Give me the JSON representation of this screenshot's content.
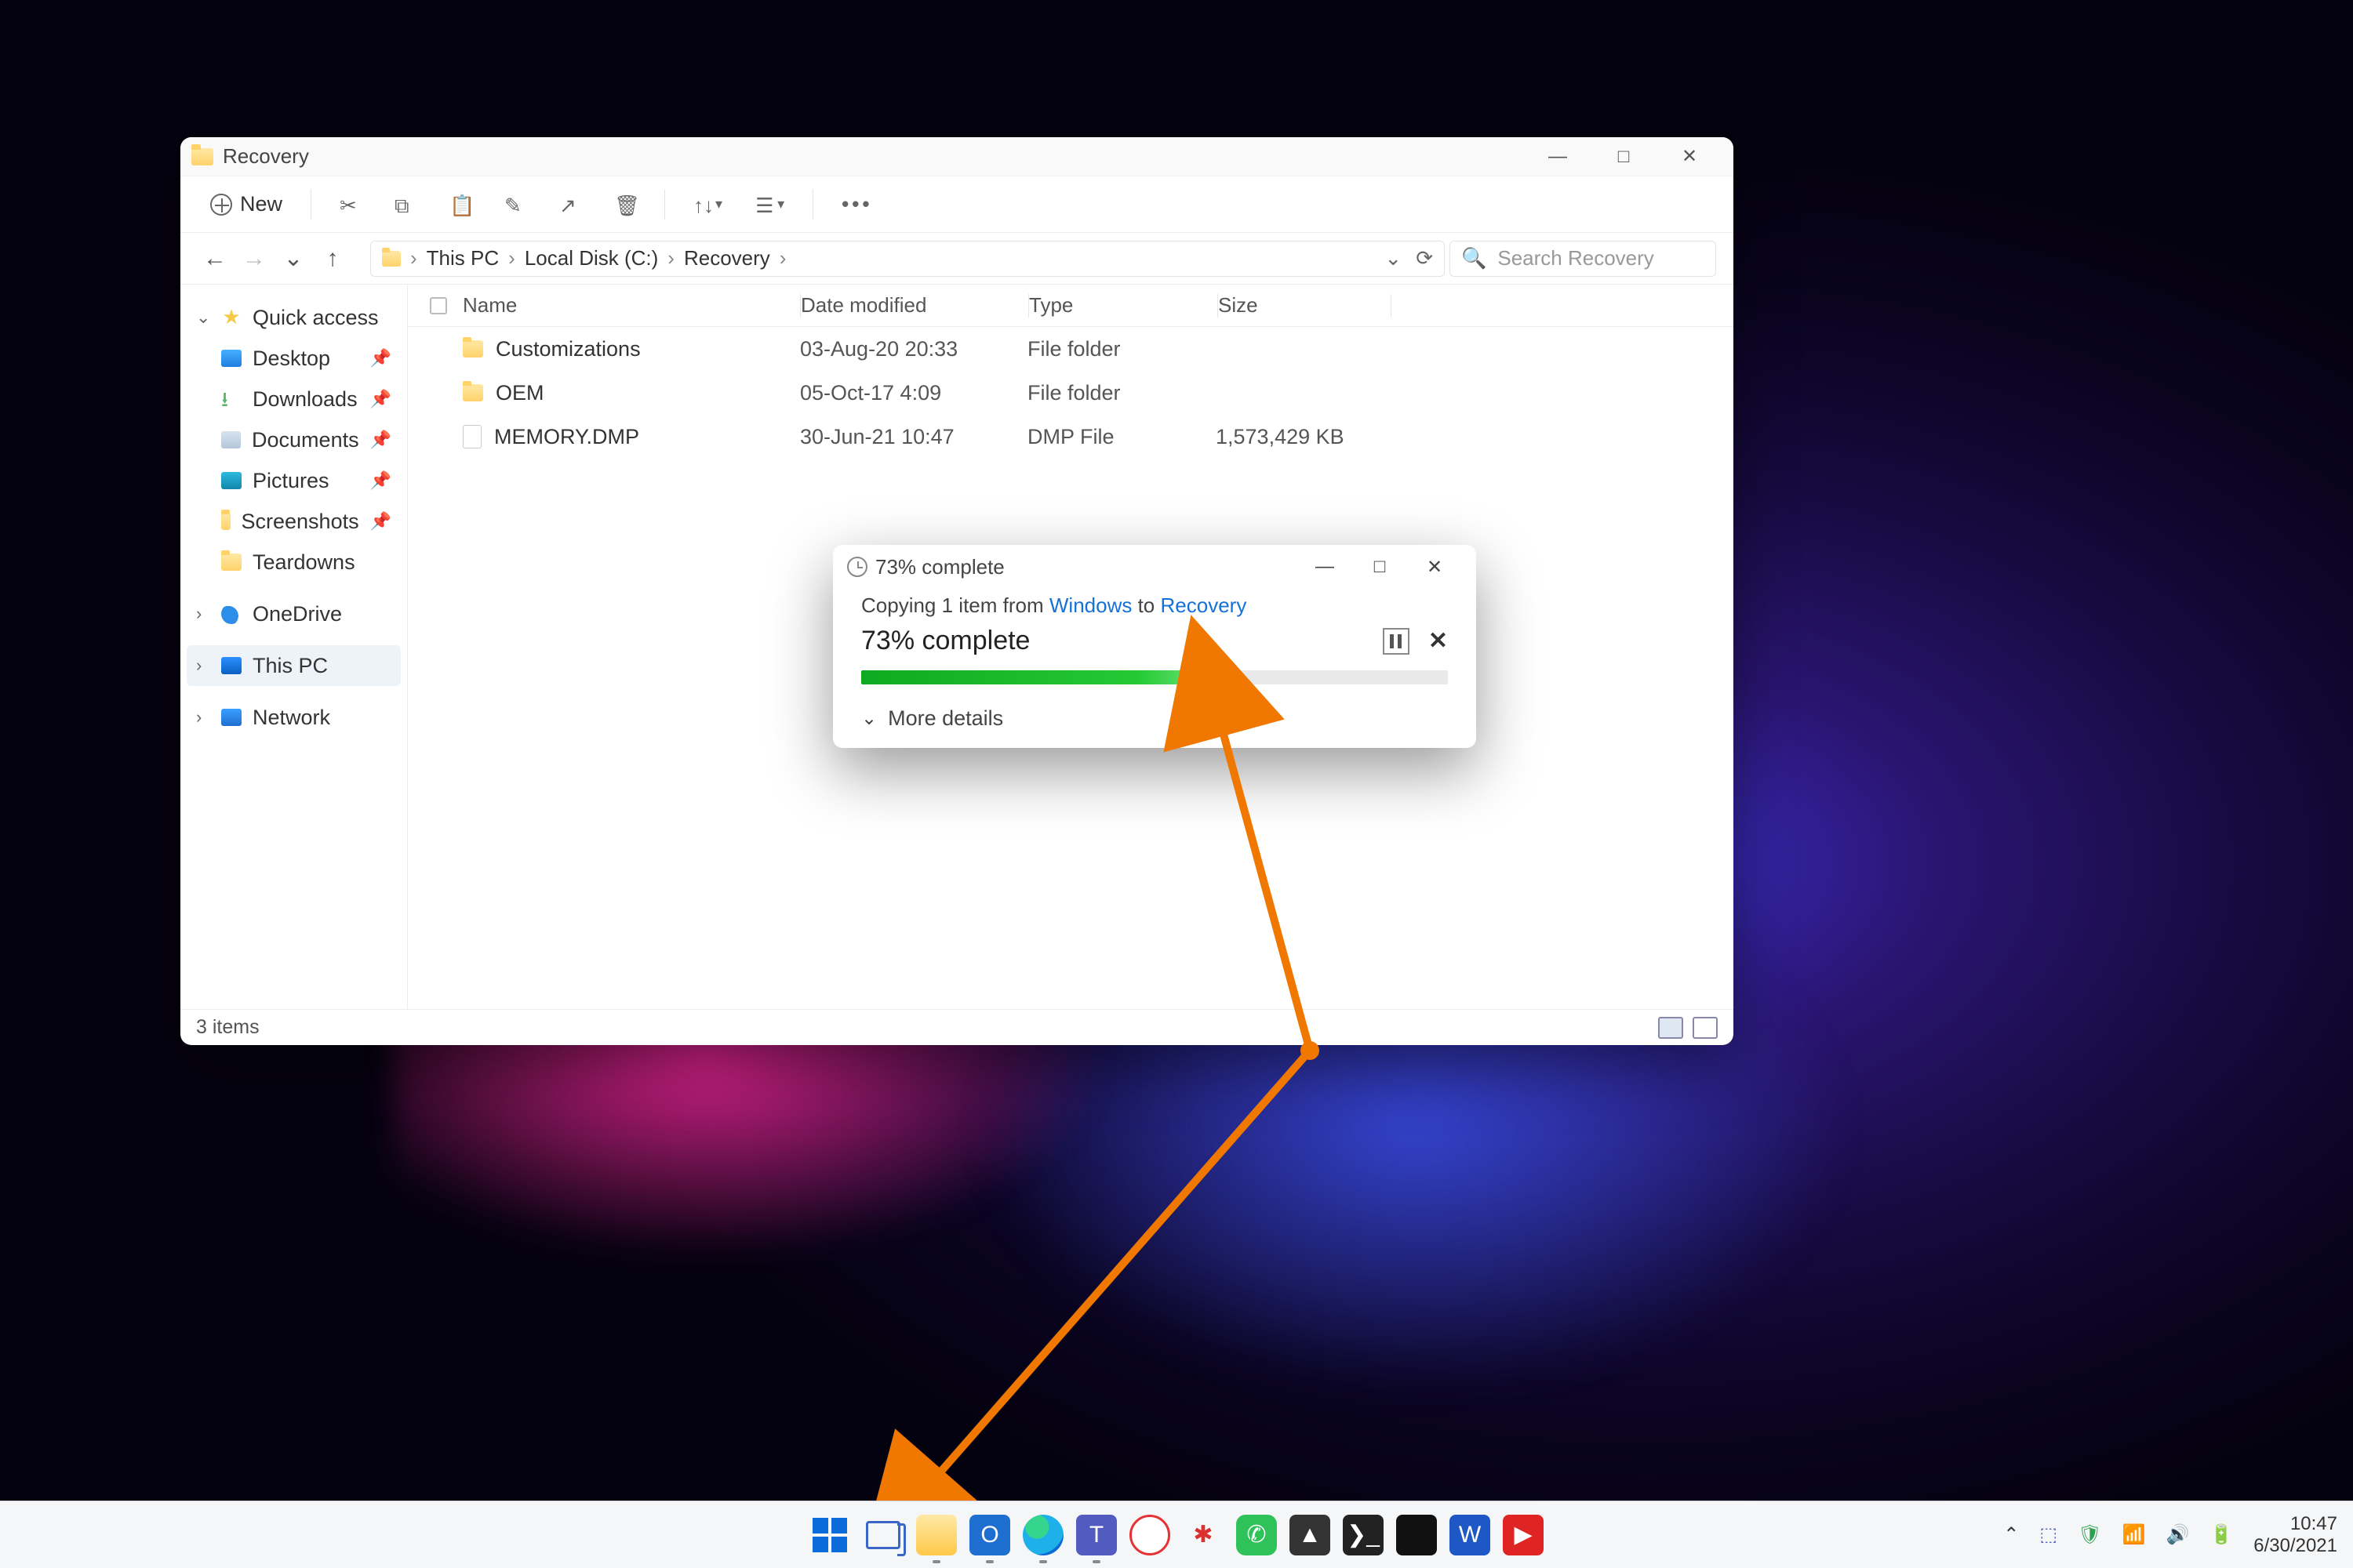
{
  "window": {
    "title": "Recovery",
    "controls": {
      "min": "—",
      "max": "□",
      "close": "✕"
    },
    "toolbar": {
      "new": "New",
      "icons": [
        "cut",
        "copy",
        "paste",
        "rename",
        "share",
        "delete",
        "sort",
        "view",
        "more"
      ]
    },
    "nav": {
      "back": "←",
      "forward": "→",
      "recent": "⌄",
      "up": "↑",
      "dropdown": "⌄",
      "refresh": "⟳"
    },
    "breadcrumb": [
      "This PC",
      "Local Disk (C:)",
      "Recovery"
    ],
    "search_placeholder": "Search Recovery",
    "status": "3 items"
  },
  "sidebar": {
    "quick_access": "Quick access",
    "items": [
      {
        "label": "Desktop",
        "pin": true,
        "ico": "desk"
      },
      {
        "label": "Downloads",
        "pin": true,
        "ico": "dl"
      },
      {
        "label": "Documents",
        "pin": true,
        "ico": "doc"
      },
      {
        "label": "Pictures",
        "pin": true,
        "ico": "pic"
      },
      {
        "label": "Screenshots",
        "pin": true,
        "ico": "folder"
      },
      {
        "label": "Teardowns",
        "pin": false,
        "ico": "folder"
      }
    ],
    "onedrive": "OneDrive",
    "thispc": "This PC",
    "network": "Network"
  },
  "columns": {
    "name": "Name",
    "date": "Date modified",
    "type": "Type",
    "size": "Size"
  },
  "files": [
    {
      "name": "Customizations",
      "date": "03-Aug-20 20:33",
      "type": "File folder",
      "size": "",
      "ico": "fold"
    },
    {
      "name": "OEM",
      "date": "05-Oct-17 4:09",
      "type": "File folder",
      "size": "",
      "ico": "fold"
    },
    {
      "name": "MEMORY.DMP",
      "date": "30-Jun-21 10:47",
      "type": "DMP File",
      "size": "1,573,429 KB",
      "ico": "file"
    }
  ],
  "dialog": {
    "title": "73% complete",
    "line_prefix": "Copying 1 item from ",
    "src": "Windows",
    "mid": " to ",
    "dst": "Recovery",
    "big": "73% complete",
    "progress_pct": 59,
    "more": "More details",
    "controls": {
      "min": "—",
      "max": "□",
      "close": "✕"
    }
  },
  "taskbar": {
    "apps": [
      "start",
      "taskview",
      "explorer",
      "outlook",
      "edge",
      "teams",
      "opera",
      "virus",
      "whatsapp",
      "brave",
      "terminal",
      "dark",
      "word",
      "youtube"
    ],
    "tray": {
      "teams": "⬚",
      "defender": "🛡",
      "wifi": "📶",
      "sound": "🔊",
      "battery": "🔋"
    },
    "time": "10:47",
    "date": "6/30/2021"
  }
}
